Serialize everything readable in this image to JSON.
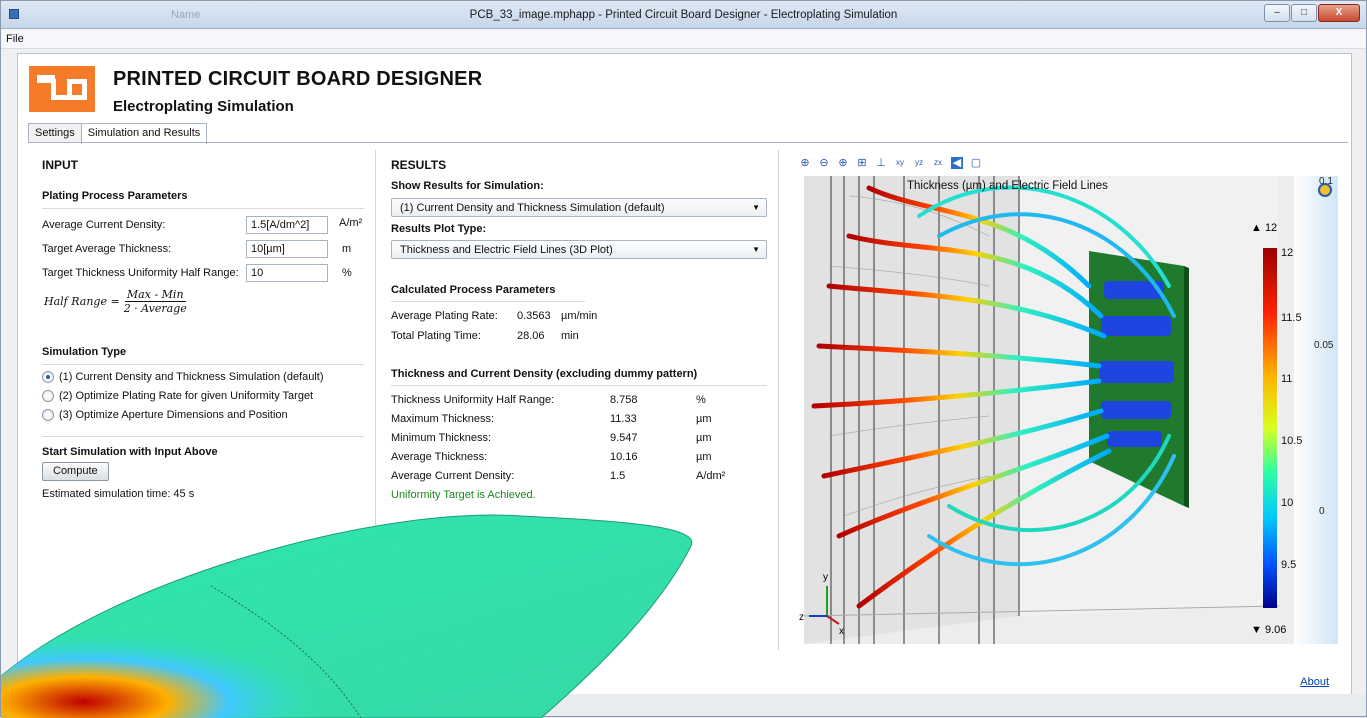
{
  "window": {
    "title": "PCB_33_image.mphapp - Printed Circuit Board Designer - Electroplating Simulation",
    "faded_text": "Name",
    "minimize": "–",
    "maximize": "□",
    "close": "X"
  },
  "menu": {
    "file": "File"
  },
  "app": {
    "title": "PRINTED CIRCUIT BOARD DESIGNER",
    "subtitle": "Electroplating Simulation"
  },
  "tabs": [
    "Settings",
    "Simulation and Results"
  ],
  "input": {
    "heading": "INPUT",
    "plating_heading": "Plating Process Parameters",
    "rows": [
      {
        "label": "Average Current Density:",
        "value": "1.5[A/dm^2]",
        "unit": "A/m²"
      },
      {
        "label": "Target Average Thickness:",
        "value": "10[µm]",
        "unit": "m"
      },
      {
        "label": "Target Thickness Uniformity Half Range:",
        "value": "10",
        "unit": "%"
      }
    ],
    "formula": {
      "lhs": "Half Range =",
      "num": "Max  - Min",
      "den": "2 · Average"
    },
    "sim_type_heading": "Simulation Type",
    "sim_types": [
      "(1) Current Density and Thickness Simulation (default)",
      "(2) Optimize Plating Rate for given Uniformity Target",
      "(3) Optimize Aperture Dimensions and Position"
    ],
    "selected_sim_type": 0,
    "start_heading": "Start Simulation with Input Above",
    "compute_label": "Compute",
    "estimate": "Estimated simulation time: 45 s"
  },
  "results": {
    "heading": "RESULTS",
    "show_label": "Show Results for Simulation:",
    "show_value": "(1) Current Density and Thickness Simulation (default)",
    "plot_type_label": "Results Plot Type:",
    "plot_type_value": "Thickness and Electric Field Lines (3D Plot)",
    "calc_heading": "Calculated Process Parameters",
    "calc_rows": [
      {
        "label": "Average Plating Rate:",
        "value": "0.3563",
        "unit": "µm/min"
      },
      {
        "label": "Total Plating Time:",
        "value": "28.06",
        "unit": "min"
      }
    ],
    "tcd_heading": "Thickness and Current Density (excluding dummy pattern)",
    "tcd_rows": [
      {
        "label": "Thickness Uniformity Half Range:",
        "value": "8.758",
        "unit": "%"
      },
      {
        "label": "Maximum Thickness:",
        "value": "11.33",
        "unit": "µm"
      },
      {
        "label": "Minimum Thickness:",
        "value": "9.547",
        "unit": "µm"
      },
      {
        "label": "Average Thickness:",
        "value": "10.16",
        "unit": "µm"
      },
      {
        "label": "Average Current Density:",
        "value": "1.5",
        "unit": "A/dm²"
      }
    ],
    "status": "Uniformity Target is Achieved."
  },
  "plot": {
    "title": "Thickness (µm) and Electric Field Lines",
    "toolbar": [
      "zoom-in-icon",
      "zoom-out-icon",
      "zoom-box-icon",
      "zoom-extents-icon",
      "axis-icon",
      "xy-view-icon",
      "yz-view-icon",
      "zx-view-icon",
      "light-icon",
      "window-icon"
    ],
    "toolbar_glyphs": [
      "⊕",
      "⊖",
      "⊕",
      "⊞",
      "⊥",
      "xy",
      "yz",
      "zx",
      "◀",
      "▢"
    ],
    "colorbar_max": "▲ 12",
    "colorbar_min": "▼ 9.06",
    "colorbar_ticks": [
      "12",
      "11.5",
      "11",
      "10.5",
      "10",
      "9.5"
    ],
    "right_scale": [
      "0.1",
      "0.05",
      "0"
    ],
    "axes": {
      "y": "y",
      "z": "z",
      "x": "x"
    }
  },
  "about": "About"
}
